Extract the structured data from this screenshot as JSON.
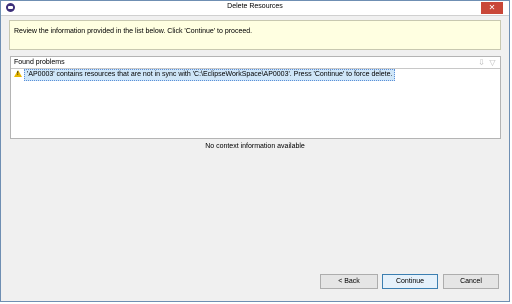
{
  "window": {
    "title": "Delete Resources",
    "close_symbol": "✕"
  },
  "message": {
    "text": "Review the information provided in the list below. Click 'Continue' to proceed."
  },
  "problems": {
    "title": "Found problems",
    "items": [
      {
        "icon": "warning-icon",
        "text": "'AP0003' contains resources that are not in sync with 'C:\\EclipseWorkSpace\\AP0003'. Press 'Continue' to force delete."
      }
    ]
  },
  "context": {
    "text": "No context information available"
  },
  "buttons": {
    "back": "< Back",
    "continue": "Continue",
    "cancel": "Cancel"
  },
  "colors": {
    "banner_bg": "#ffffe1",
    "selection_bg": "#cfe6f8",
    "close_btn": "#c94738"
  }
}
